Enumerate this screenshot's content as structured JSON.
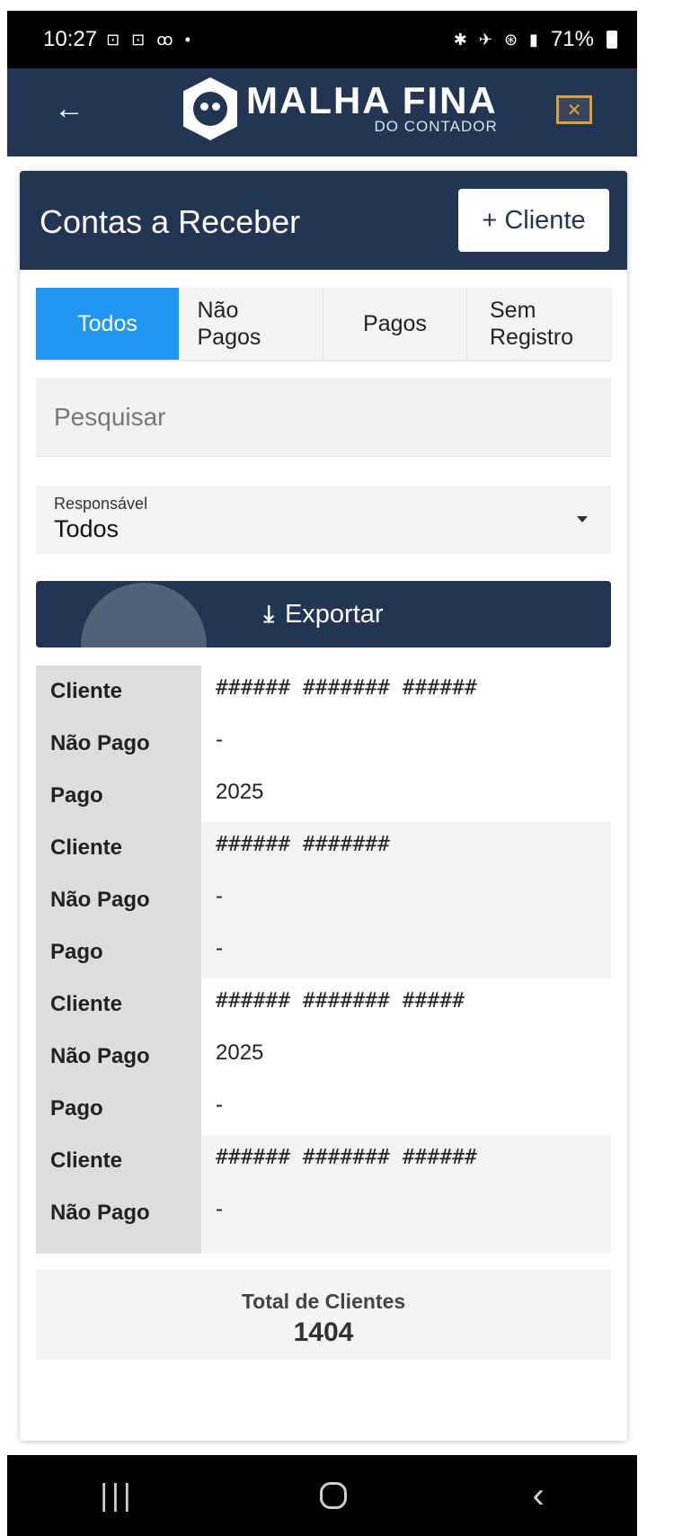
{
  "status_bar": {
    "time": "10:27",
    "left_icons": "⊡ ⊡ ꝏ •",
    "right_icons": "✱ ✈ ⊛ ▮",
    "battery": "71%"
  },
  "header": {
    "logo_main": "MALHA FINA",
    "logo_sub": "DO CONTADOR",
    "back_icon": "←",
    "close_icon": "✕",
    "brand_color": "#223654",
    "close_color": "#d8a23a"
  },
  "card": {
    "title": "Contas a Receber",
    "add_client_label": "+ Cliente"
  },
  "tabs": [
    {
      "label": "Todos",
      "active": true
    },
    {
      "label": "Não Pagos",
      "active": false
    },
    {
      "label": "Pagos",
      "active": false
    },
    {
      "label": "Sem Registro",
      "active": false
    }
  ],
  "search": {
    "placeholder": "Pesquisar"
  },
  "responsavel": {
    "label": "Responsável",
    "value": "Todos"
  },
  "export": {
    "icon": "⤓",
    "label": "Exportar"
  },
  "list_labels": {
    "cliente": "Cliente",
    "nao_pago": "Não Pago",
    "pago": "Pago"
  },
  "records": [
    {
      "cliente": "###### ####### ######",
      "nao_pago": "-",
      "pago": "2025"
    },
    {
      "cliente": "###### #######",
      "nao_pago": "-",
      "pago": "-"
    },
    {
      "cliente": "###### ####### #####",
      "nao_pago": "2025",
      "pago": "-"
    },
    {
      "cliente": "###### ####### ######",
      "nao_pago": "-",
      "pago": ""
    }
  ],
  "total": {
    "label": "Total de Clientes",
    "value": "1404"
  },
  "nav": {
    "recent": "|||",
    "home": "home",
    "back": "‹"
  },
  "accent_color": "#2196f3"
}
